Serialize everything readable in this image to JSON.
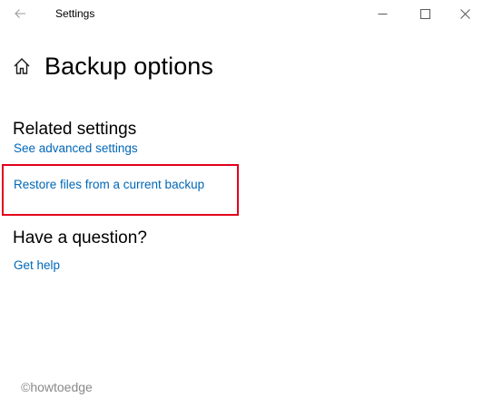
{
  "window": {
    "title": "Settings"
  },
  "header": {
    "title": "Backup options",
    "home_icon": "home-icon"
  },
  "related_settings": {
    "heading": "Related settings",
    "links": [
      "See advanced settings",
      "Restore files from a current backup"
    ]
  },
  "question": {
    "heading": "Have a question?",
    "link": "Get help"
  },
  "annotation": {
    "highlight_color": "#e3001b"
  },
  "watermark": "©howtoedge",
  "colors": {
    "link": "#0067b8",
    "text": "#000000",
    "background": "#ffffff"
  }
}
